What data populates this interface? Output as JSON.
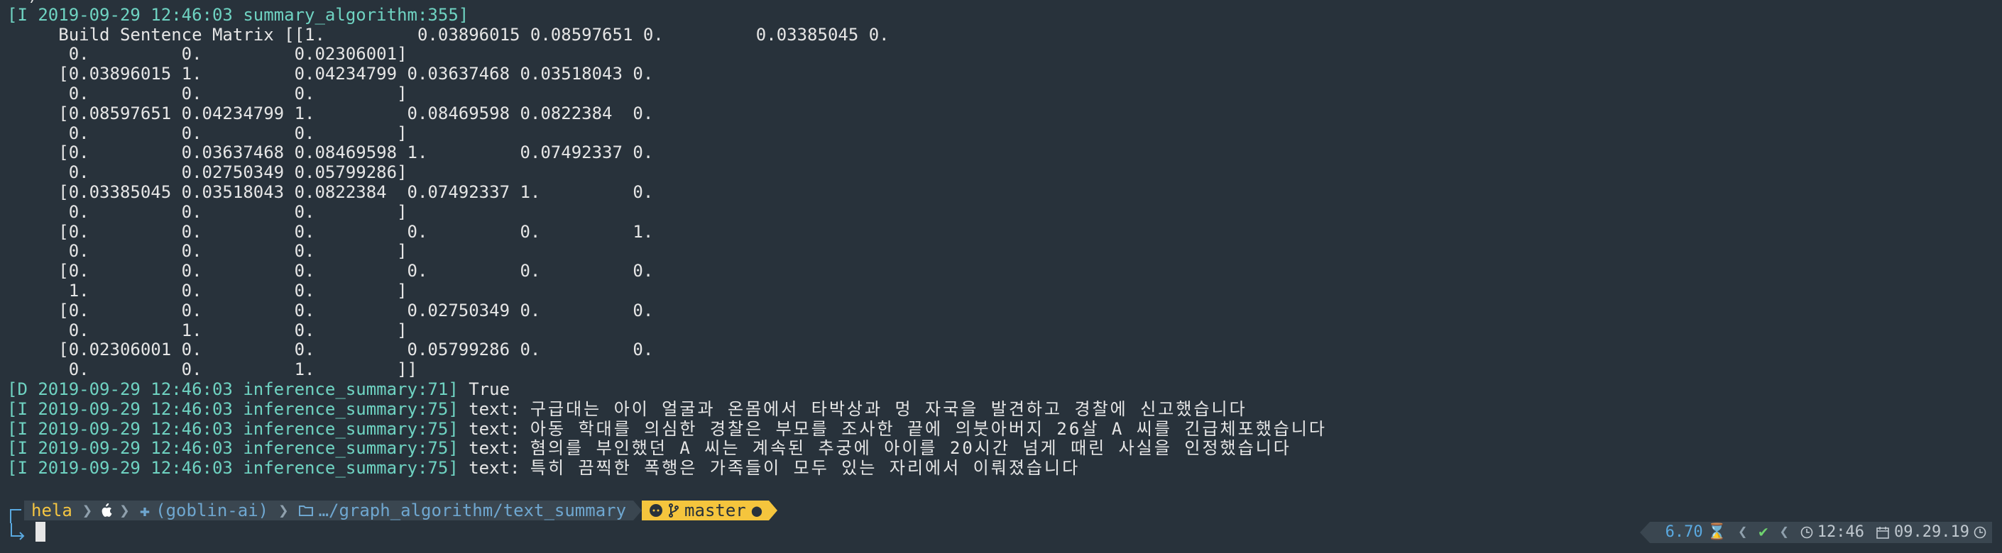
{
  "terminal": {
    "lines": [
      {
        "text": "  )"
      },
      {
        "level": "[I 2019-09-29 12:46:03 summary_algorithm:355]",
        "text": ""
      },
      {
        "text": "     Build Sentence Matrix [[1.         0.03896015 0.08597651 0.         0.03385045 0."
      },
      {
        "text": "      0.         0.         0.02306001]"
      },
      {
        "text": "     [0.03896015 1.         0.04234799 0.03637468 0.03518043 0."
      },
      {
        "text": "      0.         0.         0.        ]"
      },
      {
        "text": "     [0.08597651 0.04234799 1.         0.08469598 0.0822384  0."
      },
      {
        "text": "      0.         0.         0.        ]"
      },
      {
        "text": "     [0.         0.03637468 0.08469598 1.         0.07492337 0."
      },
      {
        "text": "      0.         0.02750349 0.05799286]"
      },
      {
        "text": "     [0.03385045 0.03518043 0.0822384  0.07492337 1.         0."
      },
      {
        "text": "      0.         0.         0.        ]"
      },
      {
        "text": "     [0.         0.         0.         0.         0.         1."
      },
      {
        "text": "      0.         0.         0.        ]"
      },
      {
        "text": "     [0.         0.         0.         0.         0.         0."
      },
      {
        "text": "      1.         0.         0.        ]"
      },
      {
        "text": "     [0.         0.         0.         0.02750349 0.         0."
      },
      {
        "text": "      0.         1.         0.        ]"
      },
      {
        "text": "     [0.02306001 0.         0.         0.05799286 0.         0."
      },
      {
        "text": "      0.         0.         1.        ]]"
      },
      {
        "level": "[D 2019-09-29 12:46:03 inference_summary:71]",
        "text": " True"
      },
      {
        "level": "[I 2019-09-29 12:46:03 inference_summary:75]",
        "text": " text: ",
        "ko": "구급대는 아이 얼굴과 온몸에서 타박상과 멍 자국을 발견하고 경찰에 신고했습니다"
      },
      {
        "level": "[I 2019-09-29 12:46:03 inference_summary:75]",
        "text": " text: ",
        "ko": "아동 학대를 의심한 경찰은 부모를 조사한 끝에 의붓아버지 26살 A 씨를 긴급체포했습니다"
      },
      {
        "level": "[I 2019-09-29 12:46:03 inference_summary:75]",
        "text": " text: ",
        "ko": "혐의를 부인했던 A 씨는 계속된 추궁에 아이를 20시간 넘게 때린 사실을 인정했습니다"
      },
      {
        "level": "[I 2019-09-29 12:46:03 inference_summary:75]",
        "text": " text: ",
        "ko": "특히 끔찍한 폭행은 가족들이 모두 있는 자리에서 이뤄졌습니다"
      }
    ]
  },
  "prompt": {
    "host": "hela",
    "env": "(goblin-ai)",
    "path": "…/graph_algorithm/text_summary",
    "branch": "master",
    "dirty": "●"
  },
  "status": {
    "load": "6.70",
    "time": "12:46",
    "date": "09.29.19"
  }
}
